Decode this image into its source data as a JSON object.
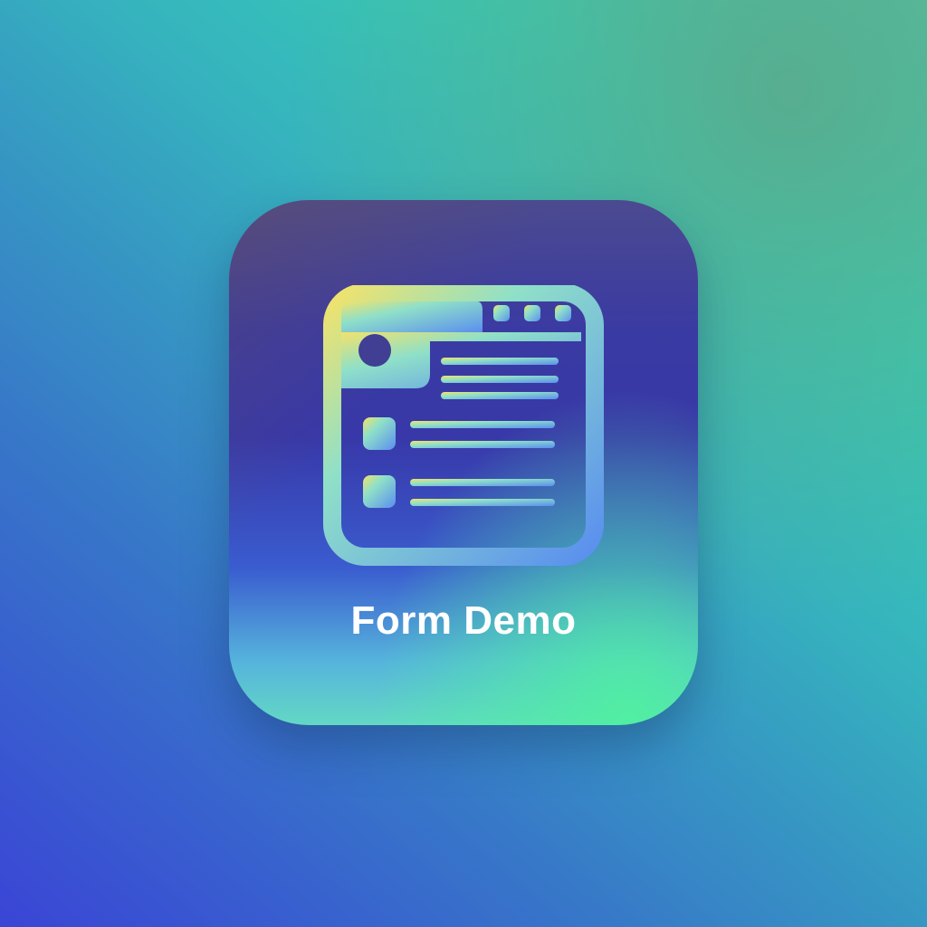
{
  "app": {
    "name": "Form Demo",
    "icon": "form-window-icon"
  },
  "colors": {
    "label_text": "#ffffff",
    "glyph_gradient_start": "#f3e26a",
    "glyph_gradient_mid": "#8fe0c8",
    "glyph_gradient_end": "#5a8fef"
  }
}
